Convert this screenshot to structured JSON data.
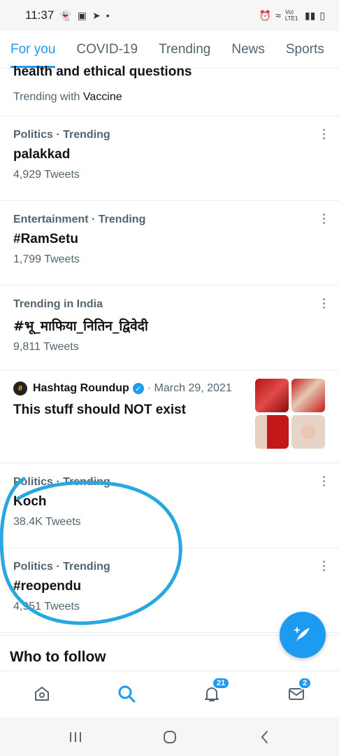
{
  "status_bar": {
    "time": "11:37",
    "network_label": "Vo) LTE1"
  },
  "tabs": [
    {
      "label": "For you",
      "active": true
    },
    {
      "label": "COVID-19",
      "active": false
    },
    {
      "label": "Trending",
      "active": false
    },
    {
      "label": "News",
      "active": false
    },
    {
      "label": "Sports",
      "active": false
    }
  ],
  "partial_item": {
    "title": "health and ethical questions",
    "sub_prefix": "Trending with",
    "sub_topic": "Vaccine"
  },
  "trends": [
    {
      "meta": "Politics · Trending",
      "name": "palakkad",
      "count": "4,929 Tweets"
    },
    {
      "meta": "Entertainment · Trending",
      "name": "#RamSetu",
      "count": "1,799 Tweets"
    },
    {
      "meta": "Trending in India",
      "name": "#भू_माफिया_नितिन_द्विवेदी",
      "count": "9,811 Tweets"
    }
  ],
  "promo": {
    "author": "Hashtag Roundup",
    "date": "· March 29, 2021",
    "headline": "This stuff should NOT exist"
  },
  "trends2": [
    {
      "meta": "Politics · Trending",
      "name": "Koch",
      "count": "38.4K Tweets"
    },
    {
      "meta": "Politics · Trending",
      "name": "#reopendu",
      "count": "4,951 Tweets"
    }
  ],
  "who_to_follow": "Who to follow",
  "bottom_nav": {
    "notifications_badge": "21",
    "messages_badge": "2"
  },
  "colors": {
    "accent": "#1d9bf0",
    "annotation": "#29a8e0"
  }
}
